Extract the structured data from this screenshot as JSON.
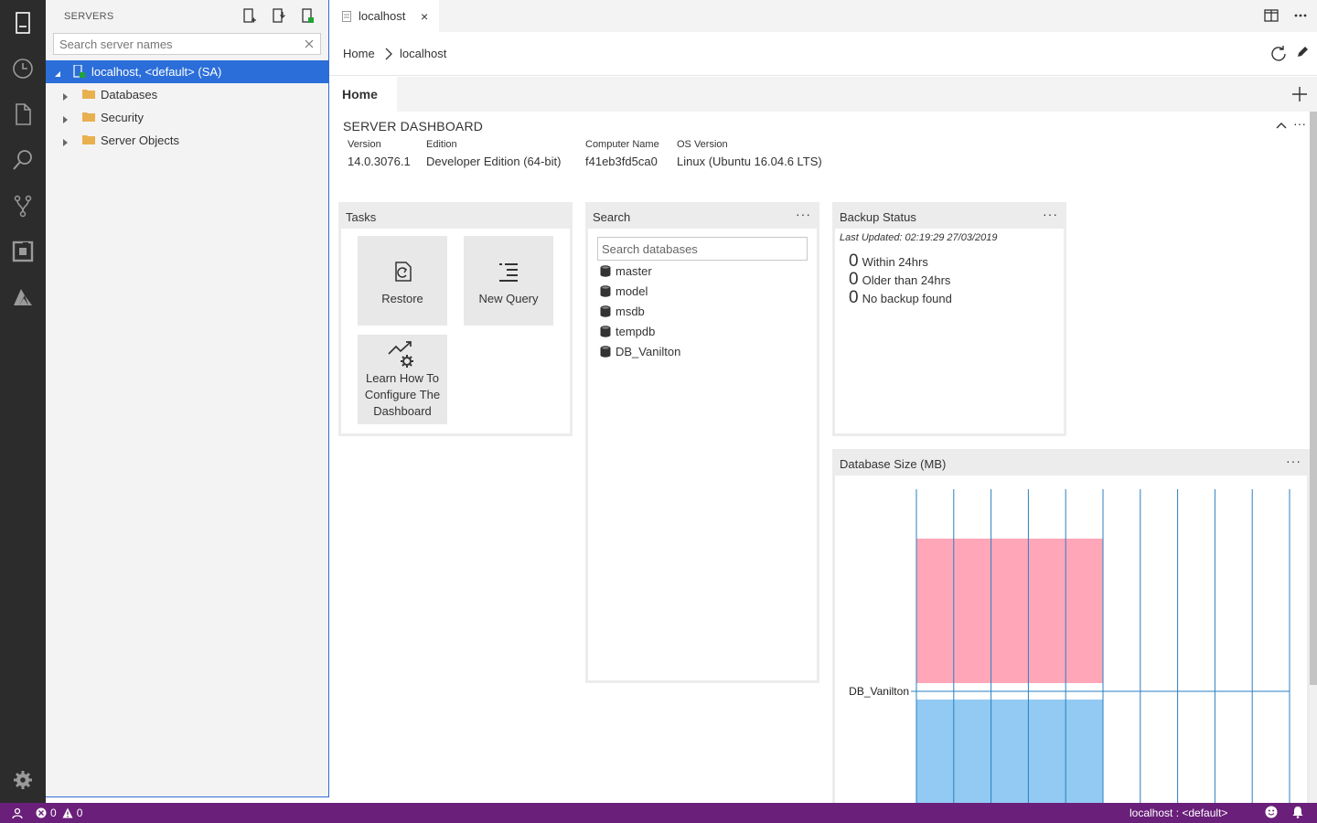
{
  "sidebar": {
    "title": "SERVERS",
    "search_placeholder": "Search server names",
    "tree": [
      {
        "label": "localhost, <default> (SA)"
      },
      {
        "label": "Databases"
      },
      {
        "label": "Security"
      },
      {
        "label": "Server Objects"
      }
    ]
  },
  "tab": {
    "label": "localhost",
    "close": "×"
  },
  "breadcrumb": {
    "home": "Home",
    "current": "localhost"
  },
  "home_tab": {
    "label": "Home"
  },
  "dashboard": {
    "title": "SERVER DASHBOARD",
    "props": [
      {
        "key": "Version",
        "value": "14.0.3076.1"
      },
      {
        "key": "Edition",
        "value": "Developer Edition (64-bit)"
      },
      {
        "key": "Computer Name",
        "value": "f41eb3fd5ca0"
      },
      {
        "key": "OS Version",
        "value": "Linux (Ubuntu 16.04.6 LTS)"
      }
    ],
    "more": "···"
  },
  "tasks": {
    "title": "Tasks",
    "restore": "Restore",
    "new_query": "New Query",
    "learn_1": "Learn How To",
    "learn_2": "Configure The",
    "learn_3": "Dashboard"
  },
  "search_widget": {
    "title": "Search",
    "placeholder": "Search databases",
    "databases": [
      "master",
      "model",
      "msdb",
      "tempdb",
      "DB_Vanilton"
    ]
  },
  "backup": {
    "title": "Backup Status",
    "last_updated": "Last Updated: 02:19:29 27/03/2019",
    "rows": [
      {
        "num": "0",
        "label": "Within 24hrs"
      },
      {
        "num": "0",
        "label": "Older than 24hrs"
      },
      {
        "num": "0",
        "label": "No backup found"
      }
    ]
  },
  "chart_widget": {
    "title": "Database Size (MB)"
  },
  "chart_data": {
    "type": "bar",
    "orientation": "horizontal",
    "title": "Database Size (MB)",
    "categories": [
      "DB_Vanilton"
    ],
    "series": [
      {
        "color": "#ff9fb3",
        "values": [
          5
        ]
      },
      {
        "color": "#89c6f2",
        "values": [
          5
        ]
      }
    ],
    "xlim": [
      0,
      10
    ],
    "grid": true
  },
  "statusbar": {
    "errors": "0",
    "warnings": "0",
    "connection": "localhost : <default>"
  },
  "colors": {
    "activity_bg": "#2c2c2c",
    "selection": "#2b6ed9",
    "statusbar": "#6a1f7a"
  }
}
